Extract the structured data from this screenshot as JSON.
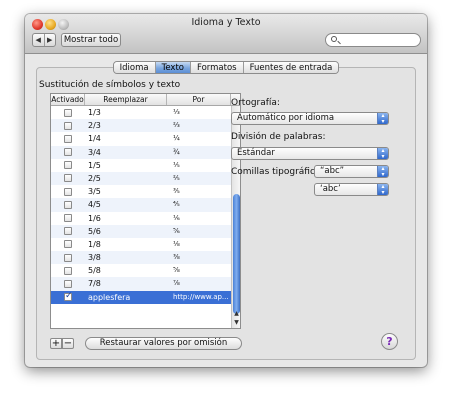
{
  "window": {
    "title": "Idioma y Texto",
    "nav_back": "◀",
    "nav_forward": "▶",
    "show_all": "Mostrar todo",
    "search_placeholder": ""
  },
  "tabs": [
    {
      "label": "Idioma",
      "active": false
    },
    {
      "label": "Texto",
      "active": true
    },
    {
      "label": "Formatos",
      "active": false
    },
    {
      "label": "Fuentes de entrada",
      "active": false
    }
  ],
  "substitution": {
    "title": "Sustitución de símbolos y texto",
    "headers": {
      "enabled": "Activado",
      "replace": "Reemplazar",
      "with": "Por"
    },
    "rows": [
      {
        "checked": false,
        "replace": "1/3",
        "with": "⅓"
      },
      {
        "checked": false,
        "replace": "2/3",
        "with": "⅔"
      },
      {
        "checked": false,
        "replace": "1/4",
        "with": "¼"
      },
      {
        "checked": false,
        "replace": "3/4",
        "with": "¾"
      },
      {
        "checked": false,
        "replace": "1/5",
        "with": "⅕"
      },
      {
        "checked": false,
        "replace": "2/5",
        "with": "⅖"
      },
      {
        "checked": false,
        "replace": "3/5",
        "with": "⅗"
      },
      {
        "checked": false,
        "replace": "4/5",
        "with": "⅘"
      },
      {
        "checked": false,
        "replace": "1/6",
        "with": "⅙"
      },
      {
        "checked": false,
        "replace": "5/6",
        "with": "⅚"
      },
      {
        "checked": false,
        "replace": "1/8",
        "with": "⅛"
      },
      {
        "checked": false,
        "replace": "3/8",
        "with": "⅜"
      },
      {
        "checked": false,
        "replace": "5/8",
        "with": "⅝"
      },
      {
        "checked": false,
        "replace": "7/8",
        "with": "⅞"
      },
      {
        "checked": true,
        "replace": "applesfera",
        "with": "http://www.ap...",
        "selected": true
      }
    ],
    "add_label": "+",
    "remove_label": "−",
    "restore_label": "Restaurar valores por omisión"
  },
  "options": {
    "spelling_label": "Ortografía:",
    "spelling_value": "Automático por idioma",
    "word_break_label": "División de palabras:",
    "word_break_value": "Estándar",
    "quotes_label": "Comillas tipográficas:",
    "double_quotes_value": "“abc”",
    "single_quotes_value": "‘abc’"
  },
  "help_label": "?"
}
